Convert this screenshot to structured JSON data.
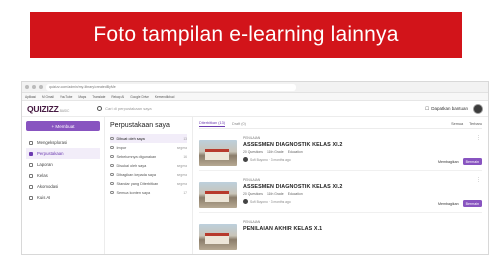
{
  "banner": {
    "title": "Foto tampilan e-learning lainnya"
  },
  "browser": {
    "url": "quizizz.com/admin/my-library/createdByMe",
    "bookmarks": [
      "Aplikasi",
      "M Gmail",
      "YouTube",
      "Maps",
      "Translate",
      "Rekap AI",
      "Google Drive",
      "Kemendikbud"
    ]
  },
  "app": {
    "logo": "QUIZIZZ",
    "plan": "BASIC",
    "search_placeholder": "Cari di perpustakaan saya",
    "help_label": "Dapatkan bantuan"
  },
  "sidebar": {
    "create_label": "+ Membuat",
    "items": [
      {
        "label": "Mengeksplorasi",
        "active": false
      },
      {
        "label": "Perpustakaan",
        "active": true
      },
      {
        "label": "Laporan",
        "active": false
      },
      {
        "label": "Kelas",
        "active": false
      },
      {
        "label": "Akomodasi",
        "active": false
      },
      {
        "label": "Kuis AI",
        "active": false
      }
    ]
  },
  "library": {
    "title": "Perpustakaan saya",
    "filters": [
      {
        "label": "Dibuat oleh saya",
        "count": "13",
        "active": true
      },
      {
        "label": "Impor",
        "count": "segera",
        "active": false
      },
      {
        "label": "Sebelumnya digunakan",
        "count": "16",
        "active": false
      },
      {
        "label": "Disukai oleh saya",
        "count": "segera",
        "active": false
      },
      {
        "label": "Dibagikan kepada saya",
        "count": "segera",
        "active": false
      },
      {
        "label": "Standar yang Diterbitkan",
        "count": "segera",
        "active": false
      },
      {
        "label": "Semua konten saya",
        "count": "17",
        "active": false
      }
    ]
  },
  "content": {
    "tabs": [
      {
        "label": "Diterbitkan (13)",
        "active": true
      },
      {
        "label": "Draft (0)",
        "active": false
      }
    ],
    "sort": [
      "Semua",
      "Terbaru"
    ],
    "cards": [
      {
        "type": "PENILAIAN",
        "title": "ASSESMEN DIAGNOSTIK KELAS XI.2",
        "questions": "20 Questions",
        "grade": "11th Grade",
        "subject": "Education",
        "author": "Sofi Buyono · 3 months ago",
        "share_label": "Membagikan",
        "play_label": "Bermain"
      },
      {
        "type": "PENILAIAN",
        "title": "ASSESMEN DIAGNOSTIK KELAS XI.2",
        "questions": "20 Questions",
        "grade": "11th Grade",
        "subject": "Education",
        "author": "Sofi Buyono · 3 months ago",
        "share_label": "Membagikan",
        "play_label": "Bermain"
      },
      {
        "type": "PENILAIAN",
        "title": "PENILAIAN AKHIR KELAS X.1",
        "questions": "",
        "grade": "",
        "subject": "",
        "author": "",
        "share_label": "",
        "play_label": ""
      }
    ]
  },
  "colors": {
    "banner": "#d2141a",
    "accent": "#8854c0",
    "logo": "#461a42"
  }
}
